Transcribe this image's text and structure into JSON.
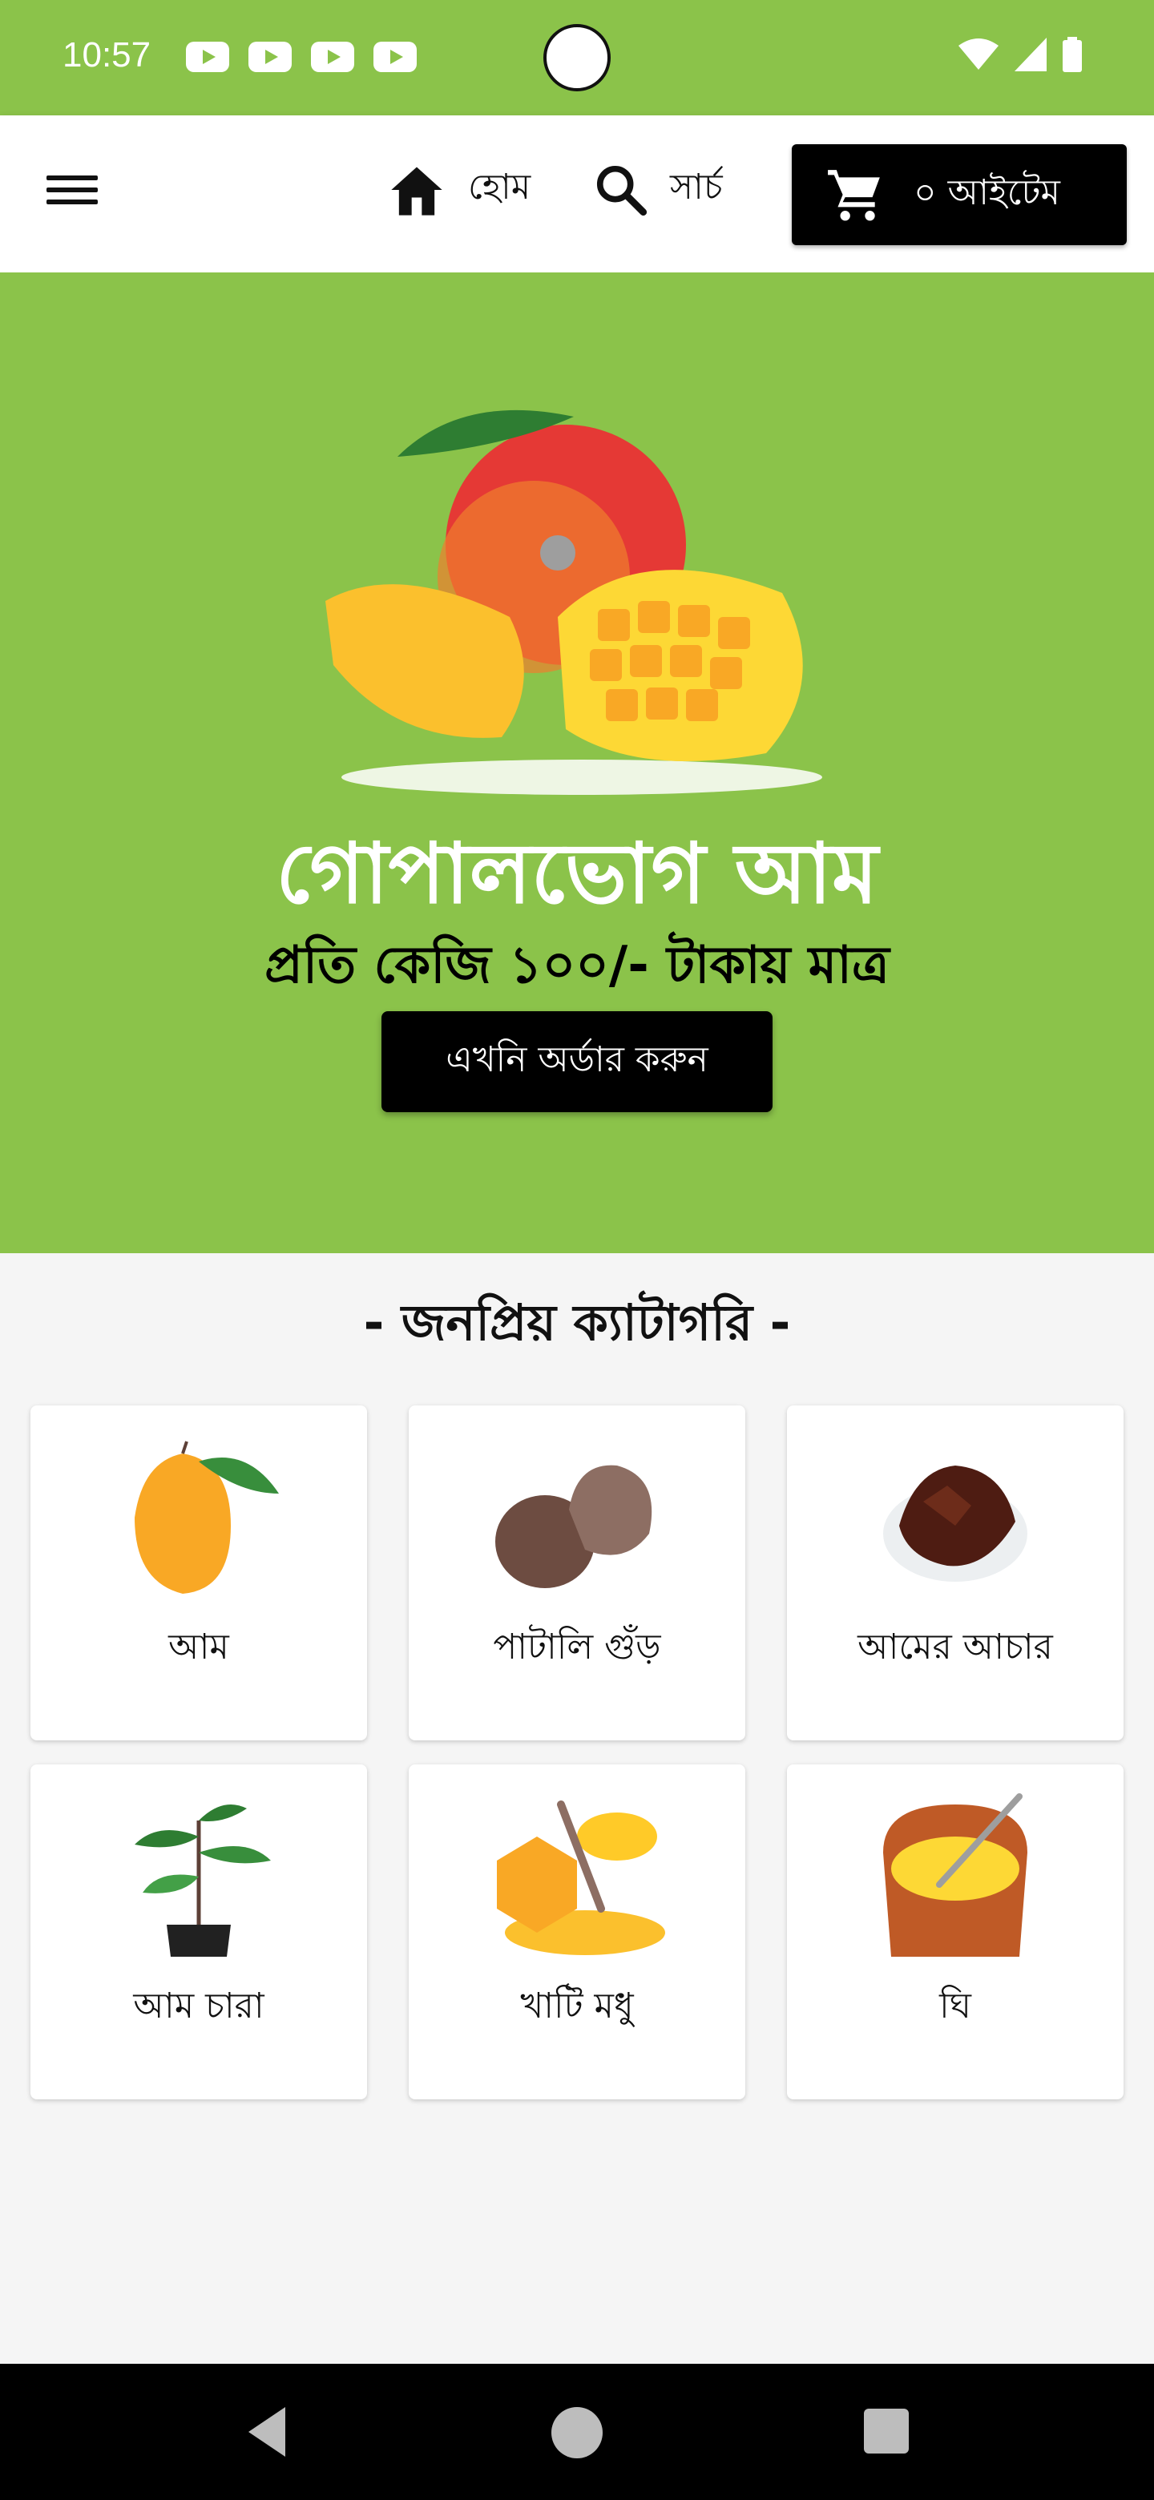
{
  "status_bar": {
    "time": "10:57"
  },
  "header": {
    "home_label": "হোম",
    "search_label": "সার্চ",
    "cart_label": "০ আইটেম"
  },
  "hero": {
    "title": "গোপালভোগ আম",
    "subtitle": "প্রতি কেজি ১০০/- টাকায় মাত্র",
    "button_label": "এখনি অর্ডার করুন",
    "background_color": "#8bc34a"
  },
  "categories": {
    "title": "- জনপ্রিয় ক্যাটাগরি -",
    "items": [
      {
        "label": "আম",
        "icon": "mango-icon"
      },
      {
        "label": "পাটালি গুঁড়",
        "icon": "jaggery-icon"
      },
      {
        "label": "আমের আচার",
        "icon": "pickle-icon"
      },
      {
        "label": "আম চারা",
        "icon": "sapling-icon"
      },
      {
        "label": "খাটি মধু",
        "icon": "honey-icon"
      },
      {
        "label": "ঘি",
        "icon": "ghee-icon"
      }
    ]
  }
}
